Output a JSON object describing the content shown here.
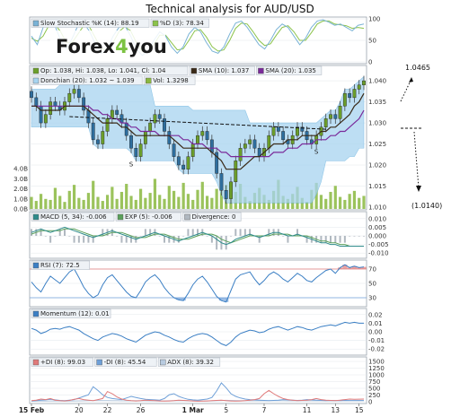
{
  "title": "Technical analysis for AUD/USD",
  "logo": {
    "text_a": "Forex",
    "digit": "4",
    "text_b": "you"
  },
  "colors": {
    "bull": "#6b9e2a",
    "bear": "#2e6e9e",
    "band": "#a7d4f0",
    "band_edge": "#6cb4e0",
    "sma10": "#3a2a18",
    "sma20": "#7a2a9a",
    "volume": "#8ab840",
    "stoch_k": "#7ab3d6",
    "stoch_d": "#8bc34a",
    "macd": "#2e8b8b",
    "macd_sig": "#5aa05a",
    "rsi": "#3b7fc4",
    "momentum": "#3b7fc4",
    "pdi": "#e07a7a",
    "mdi": "#6fa0d8",
    "adx": "#b8cbe0"
  },
  "chart_data": {
    "type": "line",
    "x_ticks": [
      "15 Feb",
      "20",
      "22",
      "26",
      "1 Mar",
      "5",
      "7",
      "11",
      "13",
      "15"
    ],
    "stochastic": {
      "legend": [
        "Slow Stochastic %K (14): 88.19",
        "%D (3): 78.34"
      ],
      "ylim": [
        0,
        100
      ],
      "yticks": [
        "0",
        "50",
        "100"
      ],
      "k": [
        60,
        40,
        80,
        95,
        85,
        50,
        30,
        55,
        85,
        90,
        70,
        40,
        20,
        30,
        60,
        80,
        85,
        60,
        30,
        15,
        25,
        50,
        70,
        60,
        35,
        20,
        35,
        65,
        80,
        70,
        45,
        25,
        20,
        35,
        65,
        90,
        95,
        80,
        60,
        40,
        30,
        50,
        75,
        88,
        80,
        60,
        40,
        55,
        80,
        95,
        98,
        92,
        85,
        88,
        80,
        72,
        85,
        88
      ],
      "d": [
        55,
        48,
        60,
        85,
        88,
        70,
        45,
        45,
        65,
        85,
        80,
        55,
        30,
        28,
        45,
        70,
        82,
        72,
        45,
        25,
        22,
        40,
        62,
        62,
        45,
        28,
        30,
        50,
        72,
        75,
        58,
        35,
        25,
        28,
        50,
        78,
        90,
        88,
        70,
        50,
        38,
        42,
        62,
        80,
        84,
        70,
        50,
        50,
        68,
        88,
        95,
        95,
        88,
        86,
        84,
        78,
        80,
        78
      ]
    },
    "price": {
      "legend": [
        "Op: 1.038, Hi: 1.038, Lo: 1.041, Cl: 1.04",
        "SMA (10): 1.037",
        "SMA (20): 1.035",
        "Donchian (20): 1.032 ~ 1.039",
        "Vol: 1.3298"
      ],
      "ylim": [
        1.01,
        1.043
      ],
      "yticks": [
        "1.010",
        "1.015",
        "1.020",
        "1.025",
        "1.030",
        "1.035",
        "1.040"
      ],
      "vol_ticks": [
        "0.0B",
        "1.0B",
        "2.0B",
        "3.0B",
        "4.0B"
      ],
      "close": [
        1.036,
        1.034,
        1.03,
        1.032,
        1.035,
        1.034,
        1.033,
        1.035,
        1.037,
        1.038,
        1.036,
        1.033,
        1.03,
        1.026,
        1.025,
        1.028,
        1.031,
        1.033,
        1.032,
        1.03,
        1.027,
        1.024,
        1.022,
        1.025,
        1.028,
        1.03,
        1.032,
        1.031,
        1.028,
        1.025,
        1.022,
        1.02,
        1.019,
        1.022,
        1.025,
        1.027,
        1.028,
        1.026,
        1.023,
        1.018,
        1.014,
        1.012,
        1.016,
        1.021,
        1.024,
        1.025,
        1.026,
        1.024,
        1.022,
        1.024,
        1.027,
        1.029,
        1.028,
        1.026,
        1.025,
        1.027,
        1.029,
        1.028,
        1.026,
        1.025,
        1.027,
        1.029,
        1.031,
        1.032,
        1.031,
        1.034,
        1.037,
        1.036,
        1.038,
        1.039,
        1.04
      ],
      "sma10": [
        1.034,
        1.034,
        1.033,
        1.033,
        1.033,
        1.033,
        1.033,
        1.034,
        1.034,
        1.034,
        1.034,
        1.034,
        1.033,
        1.032,
        1.031,
        1.03,
        1.03,
        1.03,
        1.03,
        1.029,
        1.029,
        1.028,
        1.027,
        1.027,
        1.027,
        1.027,
        1.027,
        1.027,
        1.027,
        1.027,
        1.026,
        1.025,
        1.024,
        1.024,
        1.024,
        1.024,
        1.024,
        1.024,
        1.023,
        1.022,
        1.021,
        1.019,
        1.019,
        1.019,
        1.019,
        1.02,
        1.021,
        1.022,
        1.022,
        1.023,
        1.024,
        1.025,
        1.025,
        1.025,
        1.026,
        1.026,
        1.026,
        1.027,
        1.027,
        1.027,
        1.027,
        1.028,
        1.028,
        1.029,
        1.029,
        1.03,
        1.031,
        1.032,
        1.034,
        1.035,
        1.037
      ],
      "sma20": [
        1.034,
        1.034,
        1.034,
        1.034,
        1.034,
        1.034,
        1.034,
        1.034,
        1.034,
        1.034,
        1.034,
        1.034,
        1.034,
        1.033,
        1.033,
        1.032,
        1.032,
        1.031,
        1.031,
        1.03,
        1.03,
        1.029,
        1.029,
        1.028,
        1.028,
        1.028,
        1.028,
        1.027,
        1.027,
        1.027,
        1.027,
        1.027,
        1.026,
        1.026,
        1.025,
        1.025,
        1.025,
        1.024,
        1.024,
        1.024,
        1.023,
        1.023,
        1.022,
        1.022,
        1.022,
        1.022,
        1.022,
        1.022,
        1.022,
        1.022,
        1.022,
        1.023,
        1.023,
        1.023,
        1.024,
        1.024,
        1.024,
        1.025,
        1.025,
        1.025,
        1.026,
        1.026,
        1.026,
        1.027,
        1.027,
        1.028,
        1.028,
        1.029,
        1.03,
        1.031,
        1.033
      ],
      "don_hi": [
        1.038,
        1.038,
        1.038,
        1.038,
        1.038,
        1.038,
        1.039,
        1.039,
        1.039,
        1.039,
        1.039,
        1.039,
        1.039,
        1.039,
        1.039,
        1.039,
        1.039,
        1.039,
        1.039,
        1.039,
        1.039,
        1.039,
        1.039,
        1.039,
        1.039,
        1.039,
        1.034,
        1.034,
        1.034,
        1.034,
        1.034,
        1.034,
        1.034,
        1.034,
        1.033,
        1.033,
        1.033,
        1.033,
        1.033,
        1.033,
        1.033,
        1.033,
        1.033,
        1.033,
        1.033,
        1.033,
        1.03,
        1.03,
        1.03,
        1.03,
        1.03,
        1.03,
        1.03,
        1.03,
        1.03,
        1.03,
        1.03,
        1.03,
        1.03,
        1.03,
        1.03,
        1.031,
        1.032,
        1.033,
        1.033,
        1.035,
        1.038,
        1.038,
        1.039,
        1.04,
        1.041
      ],
      "don_lo": [
        1.029,
        1.029,
        1.029,
        1.029,
        1.029,
        1.029,
        1.029,
        1.029,
        1.029,
        1.029,
        1.029,
        1.029,
        1.029,
        1.025,
        1.024,
        1.024,
        1.024,
        1.024,
        1.024,
        1.024,
        1.024,
        1.023,
        1.021,
        1.021,
        1.021,
        1.021,
        1.021,
        1.021,
        1.021,
        1.021,
        1.021,
        1.019,
        1.018,
        1.018,
        1.018,
        1.018,
        1.018,
        1.018,
        1.018,
        1.016,
        1.013,
        1.011,
        1.011,
        1.011,
        1.011,
        1.011,
        1.011,
        1.011,
        1.011,
        1.011,
        1.011,
        1.011,
        1.011,
        1.011,
        1.011,
        1.011,
        1.011,
        1.011,
        1.011,
        1.011,
        1.013,
        1.016,
        1.021,
        1.021,
        1.021,
        1.021,
        1.021,
        1.022,
        1.022,
        1.024,
        1.024
      ],
      "volume": [
        1.2,
        0.8,
        1.5,
        1.0,
        0.9,
        2.1,
        1.3,
        0.7,
        1.8,
        2.4,
        1.1,
        0.9,
        1.6,
        2.8,
        1.2,
        0.8,
        1.4,
        2.2,
        1.0,
        1.7,
        2.5,
        1.3,
        0.9,
        2.0,
        1.1,
        1.6,
        3.0,
        1.4,
        1.0,
        2.3,
        1.8,
        1.2,
        2.6,
        1.5,
        0.9,
        1.9,
        2.7,
        1.3,
        1.1,
        2.0,
        3.3,
        2.4,
        1.0,
        1.7,
        2.5,
        1.2,
        0.8,
        1.6,
        2.1,
        1.4,
        0.9,
        1.8,
        2.9,
        1.3,
        1.0,
        1.5,
        2.2,
        1.1,
        0.7,
        1.9,
        2.6,
        1.4,
        1.0,
        1.7,
        2.3,
        1.2,
        0.9,
        1.5,
        1.8,
        1.1,
        1.3
      ],
      "trendline": [
        [
          8,
          1.0315
        ],
        [
          62,
          1.0285
        ]
      ],
      "annotations": [
        "S",
        "H",
        "S"
      ]
    },
    "macd": {
      "legend": [
        "MACD (5, 34): -0.006",
        "EXP (5): -0.006",
        "Divergence: 0"
      ],
      "ylim": [
        -0.012,
        0.012
      ],
      "yticks": [
        "0.010",
        "0.005",
        "0.000",
        "-0.005",
        "-0.010"
      ],
      "macd": [
        0.002,
        0.003,
        0.004,
        0.003,
        0.002,
        0.003,
        0.004,
        0.005,
        0.004,
        0.003,
        0.002,
        0.001,
        0.0,
        -0.001,
        0.0,
        0.001,
        0.002,
        0.003,
        0.002,
        0.001,
        0.0,
        -0.001,
        -0.002,
        -0.001,
        0.0,
        0.001,
        0.002,
        0.001,
        0.0,
        -0.001,
        -0.002,
        -0.003,
        -0.002,
        -0.001,
        0.0,
        0.001,
        0.002,
        0.001,
        0.0,
        -0.002,
        -0.004,
        -0.005,
        -0.004,
        -0.002,
        -0.001,
        0.0,
        0.001,
        0.0,
        -0.001,
        0.0,
        0.001,
        0.002,
        0.002,
        0.001,
        0.0,
        0.0,
        0.001,
        0.0,
        -0.001,
        -0.002,
        -0.003,
        -0.004,
        -0.004,
        -0.005,
        -0.005,
        -0.006,
        -0.006,
        -0.006,
        -0.006,
        -0.006,
        -0.006
      ],
      "signal": [
        0.001,
        0.002,
        0.003,
        0.003,
        0.003,
        0.003,
        0.003,
        0.004,
        0.004,
        0.004,
        0.003,
        0.002,
        0.001,
        0.0,
        0.0,
        0.0,
        0.001,
        0.002,
        0.002,
        0.002,
        0.001,
        0.0,
        -0.001,
        -0.001,
        -0.001,
        0.0,
        0.001,
        0.001,
        0.001,
        0.0,
        -0.001,
        -0.002,
        -0.002,
        -0.002,
        -0.001,
        0.0,
        0.001,
        0.001,
        0.001,
        0.0,
        -0.002,
        -0.003,
        -0.004,
        -0.003,
        -0.002,
        -0.001,
        0.0,
        0.0,
        0.0,
        0.0,
        0.0,
        0.001,
        0.001,
        0.001,
        0.001,
        0.0,
        0.0,
        0.0,
        0.0,
        -0.001,
        -0.002,
        -0.003,
        -0.003,
        -0.004,
        -0.004,
        -0.005,
        -0.005,
        -0.006,
        -0.006,
        -0.006,
        -0.006
      ]
    },
    "rsi": {
      "legend": "RSI (7): 72.5",
      "ylim": [
        20,
        80
      ],
      "yticks": [
        "30",
        "50",
        "70"
      ],
      "values": [
        52,
        44,
        38,
        50,
        60,
        55,
        50,
        58,
        66,
        70,
        58,
        45,
        36,
        30,
        34,
        48,
        58,
        62,
        54,
        46,
        38,
        32,
        30,
        40,
        52,
        58,
        62,
        55,
        44,
        36,
        30,
        27,
        26,
        36,
        48,
        56,
        60,
        52,
        42,
        32,
        26,
        24,
        40,
        56,
        62,
        64,
        66,
        56,
        48,
        54,
        62,
        66,
        62,
        56,
        52,
        58,
        64,
        60,
        54,
        52,
        58,
        63,
        68,
        70,
        64,
        72,
        76,
        72,
        74,
        72,
        73
      ]
    },
    "momentum": {
      "legend": "Momentum (12): 0.01",
      "ylim": [
        -0.025,
        0.025
      ],
      "yticks": [
        "0.02",
        "0.01",
        "0.00",
        "-0.01",
        "-0.02"
      ],
      "values": [
        0.004,
        0.002,
        -0.002,
        0.0,
        0.003,
        0.004,
        0.003,
        0.005,
        0.006,
        0.004,
        0.002,
        -0.002,
        -0.005,
        -0.008,
        -0.01,
        -0.006,
        -0.004,
        -0.002,
        -0.003,
        -0.005,
        -0.008,
        -0.01,
        -0.012,
        -0.008,
        -0.004,
        -0.002,
        0.0,
        -0.001,
        -0.004,
        -0.006,
        -0.009,
        -0.011,
        -0.012,
        -0.008,
        -0.005,
        -0.003,
        -0.002,
        -0.003,
        -0.006,
        -0.01,
        -0.014,
        -0.016,
        -0.012,
        -0.006,
        -0.002,
        0.0,
        0.002,
        0.001,
        -0.001,
        0.0,
        0.003,
        0.005,
        0.006,
        0.004,
        0.002,
        0.004,
        0.006,
        0.005,
        0.003,
        0.002,
        0.004,
        0.006,
        0.007,
        0.008,
        0.007,
        0.009,
        0.011,
        0.01,
        0.011,
        0.01,
        0.01
      ]
    },
    "dmi": {
      "legend": [
        "+DI (8): 99.03",
        "-DI (8): 45.54",
        "ADX (8): 39.32"
      ],
      "ylim": [
        0,
        1600
      ],
      "yticks": [
        "0",
        "250",
        "500",
        "750",
        "1000",
        "1250",
        "1500"
      ],
      "pdi": [
        40,
        60,
        100,
        80,
        120,
        60,
        40,
        30,
        50,
        90,
        120,
        80,
        60,
        40,
        80,
        120,
        380,
        300,
        180,
        100,
        60,
        40,
        30,
        40,
        60,
        50,
        40,
        30,
        25,
        30,
        40,
        60,
        50,
        40,
        30,
        20,
        25,
        30,
        40,
        50,
        60,
        40,
        30,
        25,
        30,
        40,
        60,
        80,
        120,
        300,
        420,
        300,
        200,
        120,
        80,
        60,
        40,
        50,
        60,
        80,
        120,
        80,
        60,
        50,
        40,
        60,
        80,
        100,
        90,
        95,
        99
      ],
      "mdi": [
        30,
        40,
        60,
        70,
        90,
        70,
        50,
        40,
        60,
        80,
        140,
        200,
        260,
        560,
        420,
        260,
        160,
        120,
        100,
        80,
        140,
        200,
        160,
        120,
        90,
        80,
        70,
        60,
        120,
        260,
        300,
        200,
        140,
        90,
        70,
        60,
        80,
        100,
        160,
        400,
        700,
        520,
        300,
        200,
        140,
        100,
        80,
        70,
        60,
        50,
        40,
        50,
        60,
        80,
        70,
        60,
        50,
        60,
        80,
        70,
        60,
        50,
        40,
        50,
        45,
        40,
        50,
        45,
        48,
        46,
        45
      ],
      "adx": [
        20,
        22,
        25,
        28,
        30,
        32,
        30,
        28,
        27,
        30,
        34,
        38,
        42,
        48,
        50,
        48,
        45,
        42,
        40,
        38,
        36,
        38,
        40,
        38,
        36,
        34,
        32,
        30,
        32,
        36,
        40,
        42,
        40,
        38,
        36,
        34,
        32,
        30,
        34,
        40,
        48,
        52,
        50,
        46,
        42,
        40,
        38,
        36,
        35,
        38,
        42,
        44,
        42,
        40,
        38,
        36,
        35,
        36,
        37,
        38,
        39,
        38,
        37,
        38,
        39,
        40,
        40,
        39,
        39,
        39,
        39
      ]
    },
    "projections": {
      "upper_label": "1.0465",
      "lower_label": "(1.0140)"
    }
  }
}
